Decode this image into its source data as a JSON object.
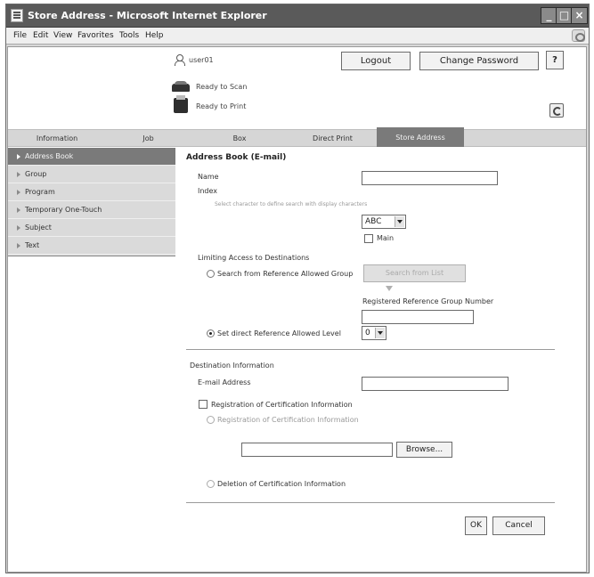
{
  "window": {
    "title": "Store Address - Microsoft Internet Explorer"
  },
  "menu": {
    "file": "File",
    "edit": "Edit",
    "view": "View",
    "favorites": "Favorites",
    "tools": "Tools",
    "help": "Help"
  },
  "header": {
    "username": "user01",
    "logout_label": "Logout",
    "change_password_label": "Change Password",
    "help_icon_label": "?",
    "scan_status": "Ready to Scan",
    "print_status": "Ready to Print"
  },
  "tabs": [
    {
      "label": "Information",
      "active": false
    },
    {
      "label": "Job",
      "active": false
    },
    {
      "label": "Box",
      "active": false
    },
    {
      "label": "Direct Print",
      "active": false
    },
    {
      "label": "Store Address",
      "active": true
    }
  ],
  "sidebar": {
    "items": [
      {
        "label": "Address Book",
        "active": true
      },
      {
        "label": "Group",
        "active": false
      },
      {
        "label": "Program",
        "active": false
      },
      {
        "label": "Temporary One-Touch",
        "active": false
      },
      {
        "label": "Subject",
        "active": false
      },
      {
        "label": "Text",
        "active": false
      }
    ]
  },
  "form": {
    "title": "Address Book (E-mail)",
    "name_label": "Name",
    "name_value": "",
    "index_label": "Index",
    "index_hint": "Select character to define search with display characters",
    "index_select_value": "ABC",
    "main_label": "Main",
    "main_checked": false,
    "limiting_access_label": "Limiting Access to Destinations",
    "search_group_label": "Search from Reference Allowed Group",
    "search_group_selected": false,
    "search_from_list_label": "Search from List",
    "registered_group_number_label": "Registered Reference Group Number",
    "registered_group_number_value": "",
    "set_level_label": "Set direct Reference Allowed Level",
    "set_level_selected": true,
    "level_value": "0",
    "destination_info_label": "Destination Information",
    "email_address_label": "E-mail Address",
    "email_address_value": "",
    "cert_checkbox_label": "Registration of Certification Information",
    "cert_checked": false,
    "cert_register_label": "Registration of Certification Information",
    "cert_file_value": "",
    "browse_label": "Browse...",
    "cert_delete_label": "Deletion of Certification Information",
    "ok_label": "OK",
    "cancel_label": "Cancel"
  },
  "colors": {
    "titlebar": "#5a5a5a",
    "active_tab": "#7a7a7a",
    "sidebar_bg": "#dadada",
    "content_bg": "#ffffff"
  }
}
